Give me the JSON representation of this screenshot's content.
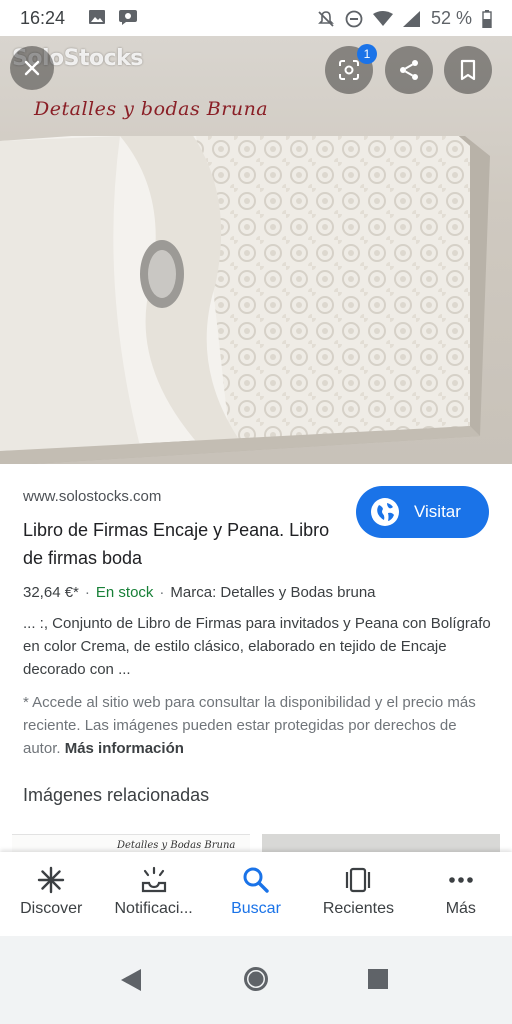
{
  "status_bar": {
    "time": "16:24",
    "battery": "52 %"
  },
  "hero": {
    "watermark": "SoloStocks",
    "caption": "Detalles y bodas Bruna",
    "lens_badge_count": "1"
  },
  "result": {
    "site_url": "www.solostocks.com",
    "title": "Libro de Firmas Encaje y Peana. Libro de firmas boda",
    "visit_label": "Visitar",
    "price": "32,64 €*",
    "stock": "En stock",
    "brand": "Marca: Detalles y Bodas bruna",
    "description": "... :, Conjunto de Libro de Firmas para invitados y Peana con Bolígrafo en color Crema, de estilo clásico, elaborado en tejido de Encaje decorado con ...",
    "notice": "* Accede al sitio web para consultar la disponibilidad y el precio más reciente. Las imágenes pueden estar protegidas por derechos de autor.",
    "more_info": "Más información",
    "related_heading": "Imágenes relacionadas",
    "related_thumb_caption": "Detalles y Bodas Bruna"
  },
  "bottom_nav": {
    "items": [
      {
        "label": "Discover",
        "icon": "asterisk-icon"
      },
      {
        "label": "Notificaci...",
        "icon": "notifications-icon"
      },
      {
        "label": "Buscar",
        "icon": "search-icon"
      },
      {
        "label": "Recientes",
        "icon": "recents-icon"
      },
      {
        "label": "Más",
        "icon": "more-icon"
      }
    ],
    "active": "Buscar"
  },
  "colors": {
    "accent": "#1a73e8",
    "stock_green": "#188038",
    "caption_red": "#8a1f26"
  }
}
